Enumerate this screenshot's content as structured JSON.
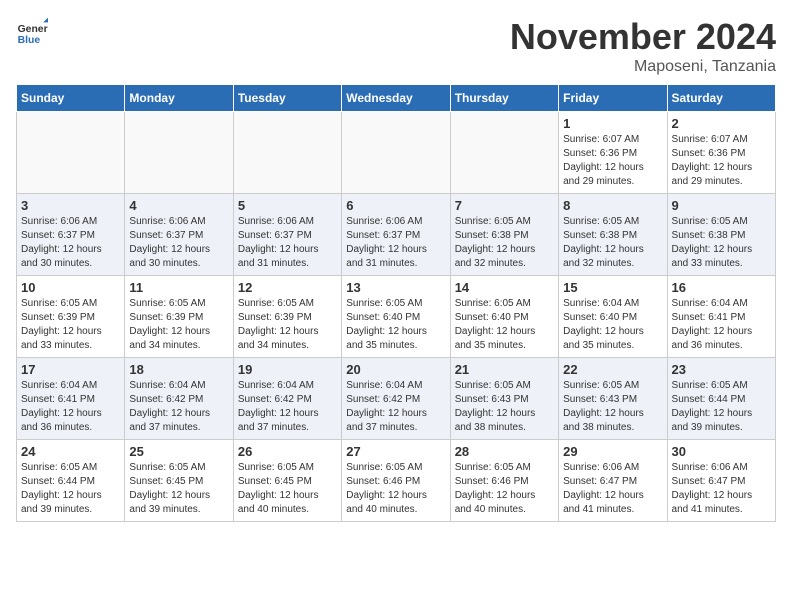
{
  "logo": {
    "general": "General",
    "blue": "Blue"
  },
  "title": "November 2024",
  "location": "Maposeni, Tanzania",
  "weekdays": [
    "Sunday",
    "Monday",
    "Tuesday",
    "Wednesday",
    "Thursday",
    "Friday",
    "Saturday"
  ],
  "weeks": [
    [
      {
        "day": "",
        "info": ""
      },
      {
        "day": "",
        "info": ""
      },
      {
        "day": "",
        "info": ""
      },
      {
        "day": "",
        "info": ""
      },
      {
        "day": "",
        "info": ""
      },
      {
        "day": "1",
        "info": "Sunrise: 6:07 AM\nSunset: 6:36 PM\nDaylight: 12 hours and 29 minutes."
      },
      {
        "day": "2",
        "info": "Sunrise: 6:07 AM\nSunset: 6:36 PM\nDaylight: 12 hours and 29 minutes."
      }
    ],
    [
      {
        "day": "3",
        "info": "Sunrise: 6:06 AM\nSunset: 6:37 PM\nDaylight: 12 hours and 30 minutes."
      },
      {
        "day": "4",
        "info": "Sunrise: 6:06 AM\nSunset: 6:37 PM\nDaylight: 12 hours and 30 minutes."
      },
      {
        "day": "5",
        "info": "Sunrise: 6:06 AM\nSunset: 6:37 PM\nDaylight: 12 hours and 31 minutes."
      },
      {
        "day": "6",
        "info": "Sunrise: 6:06 AM\nSunset: 6:37 PM\nDaylight: 12 hours and 31 minutes."
      },
      {
        "day": "7",
        "info": "Sunrise: 6:05 AM\nSunset: 6:38 PM\nDaylight: 12 hours and 32 minutes."
      },
      {
        "day": "8",
        "info": "Sunrise: 6:05 AM\nSunset: 6:38 PM\nDaylight: 12 hours and 32 minutes."
      },
      {
        "day": "9",
        "info": "Sunrise: 6:05 AM\nSunset: 6:38 PM\nDaylight: 12 hours and 33 minutes."
      }
    ],
    [
      {
        "day": "10",
        "info": "Sunrise: 6:05 AM\nSunset: 6:39 PM\nDaylight: 12 hours and 33 minutes."
      },
      {
        "day": "11",
        "info": "Sunrise: 6:05 AM\nSunset: 6:39 PM\nDaylight: 12 hours and 34 minutes."
      },
      {
        "day": "12",
        "info": "Sunrise: 6:05 AM\nSunset: 6:39 PM\nDaylight: 12 hours and 34 minutes."
      },
      {
        "day": "13",
        "info": "Sunrise: 6:05 AM\nSunset: 6:40 PM\nDaylight: 12 hours and 35 minutes."
      },
      {
        "day": "14",
        "info": "Sunrise: 6:05 AM\nSunset: 6:40 PM\nDaylight: 12 hours and 35 minutes."
      },
      {
        "day": "15",
        "info": "Sunrise: 6:04 AM\nSunset: 6:40 PM\nDaylight: 12 hours and 35 minutes."
      },
      {
        "day": "16",
        "info": "Sunrise: 6:04 AM\nSunset: 6:41 PM\nDaylight: 12 hours and 36 minutes."
      }
    ],
    [
      {
        "day": "17",
        "info": "Sunrise: 6:04 AM\nSunset: 6:41 PM\nDaylight: 12 hours and 36 minutes."
      },
      {
        "day": "18",
        "info": "Sunrise: 6:04 AM\nSunset: 6:42 PM\nDaylight: 12 hours and 37 minutes."
      },
      {
        "day": "19",
        "info": "Sunrise: 6:04 AM\nSunset: 6:42 PM\nDaylight: 12 hours and 37 minutes."
      },
      {
        "day": "20",
        "info": "Sunrise: 6:04 AM\nSunset: 6:42 PM\nDaylight: 12 hours and 37 minutes."
      },
      {
        "day": "21",
        "info": "Sunrise: 6:05 AM\nSunset: 6:43 PM\nDaylight: 12 hours and 38 minutes."
      },
      {
        "day": "22",
        "info": "Sunrise: 6:05 AM\nSunset: 6:43 PM\nDaylight: 12 hours and 38 minutes."
      },
      {
        "day": "23",
        "info": "Sunrise: 6:05 AM\nSunset: 6:44 PM\nDaylight: 12 hours and 39 minutes."
      }
    ],
    [
      {
        "day": "24",
        "info": "Sunrise: 6:05 AM\nSunset: 6:44 PM\nDaylight: 12 hours and 39 minutes."
      },
      {
        "day": "25",
        "info": "Sunrise: 6:05 AM\nSunset: 6:45 PM\nDaylight: 12 hours and 39 minutes."
      },
      {
        "day": "26",
        "info": "Sunrise: 6:05 AM\nSunset: 6:45 PM\nDaylight: 12 hours and 40 minutes."
      },
      {
        "day": "27",
        "info": "Sunrise: 6:05 AM\nSunset: 6:46 PM\nDaylight: 12 hours and 40 minutes."
      },
      {
        "day": "28",
        "info": "Sunrise: 6:05 AM\nSunset: 6:46 PM\nDaylight: 12 hours and 40 minutes."
      },
      {
        "day": "29",
        "info": "Sunrise: 6:06 AM\nSunset: 6:47 PM\nDaylight: 12 hours and 41 minutes."
      },
      {
        "day": "30",
        "info": "Sunrise: 6:06 AM\nSunset: 6:47 PM\nDaylight: 12 hours and 41 minutes."
      }
    ]
  ]
}
